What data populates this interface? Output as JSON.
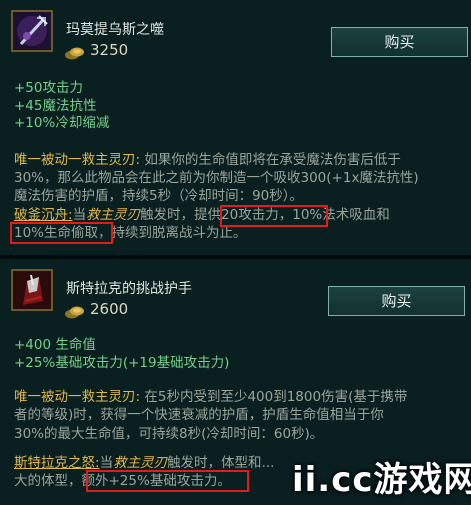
{
  "items": [
    {
      "name": "玛莫提乌斯之噬",
      "icon": "trident-amulet-icon",
      "price": "3250",
      "buy_label": "购买",
      "stats": [
        "+50攻击力",
        "+45魔法抗性",
        "+10%冷却缩减"
      ],
      "lines": [
        [
          "唯一被动一救主灵刃:",
          " 如果你的生命值即将在承受魔法伤害后低于"
        ],
        [
          "30%，那么此物品会在此之前为你制造一个吸收300(+1x魔法抗性)"
        ],
        [
          "魔法伤害的护盾，持续5秒（冷却时间：90秒）。"
        ],
        [
          "破釜沉舟:",
          "当",
          "救主灵刃",
          "触发时，",
          "提供20攻击力",
          "，10%法术吸血和"
        ],
        [
          "10%生命偷取",
          "，持续到脱离战斗为止。"
        ]
      ]
    },
    {
      "name": "斯特拉克的挑战护手",
      "icon": "gauntlet-icon",
      "price": "2600",
      "buy_label": "购买",
      "stats": [
        "+400 生命值",
        "+25%基础攻击力(+19基础攻击力)"
      ],
      "lines": [
        [
          "唯一被动一救主灵刃:",
          " 在5秒内受到至少400到1800伤害(基于携带"
        ],
        [
          "者的等级)时，获得一个快速衰减的护盾，护盾生命值相当于你"
        ],
        [
          "30%的最大生命值，可持续8秒(冷却时间：60秒)。"
        ],
        [
          "斯特拉克之怒:",
          "当",
          "救主灵刃",
          "触发时，体型和",
          "..."
        ],
        [
          "大的体型，",
          "额外+25%基础攻击力",
          "。"
        ]
      ]
    }
  ],
  "watermark": "ii.cc游戏网",
  "colors": {
    "stat": "#74d08a",
    "passive": "#e0b84c",
    "highlight": "#e41b1b"
  }
}
